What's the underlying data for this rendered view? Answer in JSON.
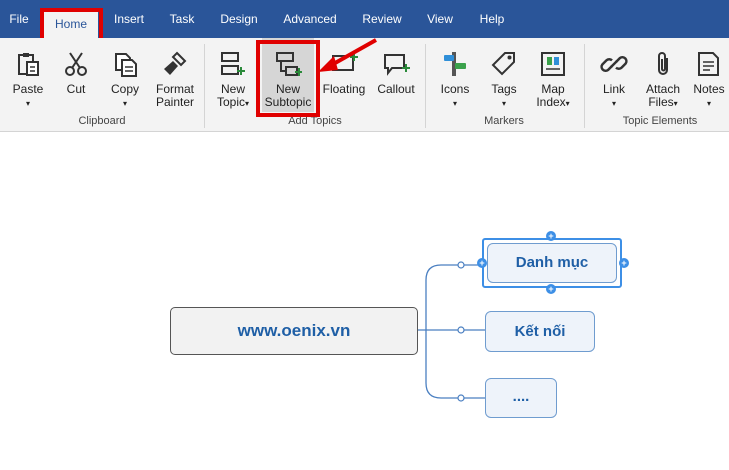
{
  "menubar": {
    "tabs": [
      {
        "label": "File"
      },
      {
        "label": "Home"
      },
      {
        "label": "Insert"
      },
      {
        "label": "Task"
      },
      {
        "label": "Design"
      },
      {
        "label": "Advanced"
      },
      {
        "label": "Review"
      },
      {
        "label": "View"
      },
      {
        "label": "Help"
      }
    ],
    "active_tab": "Home"
  },
  "ribbon": {
    "clipboard": {
      "label": "Clipboard",
      "paste": "Paste",
      "cut": "Cut",
      "copy": "Copy",
      "format_painter_1": "Format",
      "format_painter_2": "Painter"
    },
    "add_topics": {
      "label": "Add Topics",
      "new_topic_1": "New",
      "new_topic_2": "Topic",
      "new_subtopic_1": "New",
      "new_subtopic_2": "Subtopic",
      "floating": "Floating",
      "callout": "Callout"
    },
    "markers": {
      "label": "Markers",
      "icons": "Icons",
      "tags": "Tags",
      "map_index_1": "Map",
      "map_index_2": "Index"
    },
    "topic_elements": {
      "label": "Topic Elements",
      "link": "Link",
      "attach_files_1": "Attach",
      "attach_files_2": "Files",
      "notes": "Notes"
    },
    "caret": "▾"
  },
  "map": {
    "central_topic": "www.oenix.vn",
    "subtopics": [
      "Danh mục",
      "Kết nối",
      "...."
    ],
    "selected_subtopic": "Danh mục"
  },
  "colors": {
    "menubar": "#2a5599",
    "highlight": "#e00000",
    "selection": "#3d8fe6",
    "topic_text": "#1f5fa6"
  }
}
